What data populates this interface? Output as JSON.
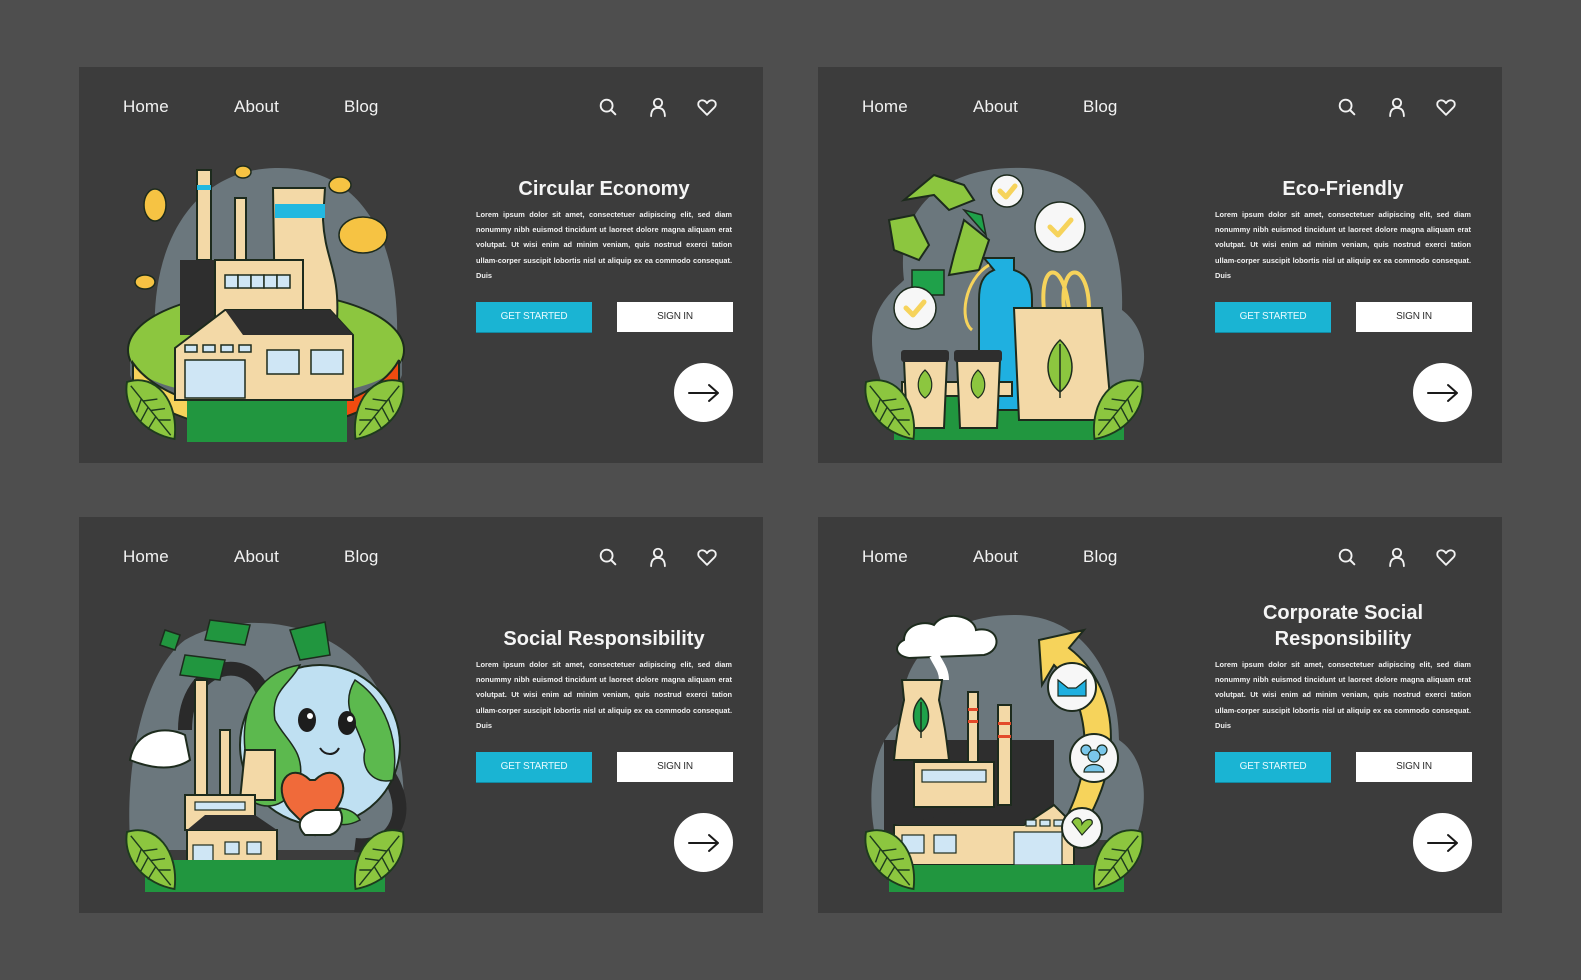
{
  "colors": {
    "page_background": "#4e4e4e",
    "panel_background": "#3c3c3c",
    "accent": "#1ab4d3",
    "text": "#f5f5f5"
  },
  "nav": {
    "links": [
      "Home",
      "About",
      "Blog"
    ],
    "icons": [
      "search-icon",
      "user-icon",
      "heart-icon"
    ]
  },
  "panels": [
    {
      "title": "Circular Economy",
      "illustration": "factory-with-circular-arrows-and-coins",
      "body": "Lorem ipsum dolor sit amet, consectetuer adipiscing elit, sed diam nonummy nibh euismod tincidunt ut laoreet dolore magna aliquam erat volutpat. Ut wisi enim ad minim veniam, quis nostrud exerci tation ullam-corper suscipit lobortis nisl ut aliquip ex ea commodo consequat. Duis",
      "primary_button": "GET STARTED",
      "secondary_button": "SIGN IN",
      "next_icon": "arrow-right-icon"
    },
    {
      "title": "Eco-Friendly",
      "illustration": "recycling-bottle-bag-cups-checkmarks",
      "body": "Lorem ipsum dolor sit amet, consectetuer adipiscing elit, sed diam nonummy nibh euismod tincidunt ut laoreet dolore magna aliquam erat volutpat. Ut wisi enim ad minim veniam, quis nostrud exerci tation ullam-corper suscipit lobortis nisl ut aliquip ex ea commodo consequat. Duis",
      "primary_button": "GET STARTED",
      "secondary_button": "SIGN IN",
      "next_icon": "arrow-right-icon"
    },
    {
      "title": "Social Responsibility",
      "illustration": "earth-character-hugging-factory-with-money",
      "body": "Lorem ipsum dolor sit amet, consectetuer adipiscing elit, sed diam nonummy nibh euismod tincidunt ut laoreet dolore magna aliquam erat volutpat. Ut wisi enim ad minim veniam, quis nostrud exerci tation ullam-corper suscipit lobortis nisl ut aliquip ex ea commodo consequat. Duis",
      "primary_button": "GET STARTED",
      "secondary_button": "SIGN IN",
      "next_icon": "arrow-right-icon"
    },
    {
      "title": "Corporate Social Responsibility",
      "illustration": "factory-with-arrow-handshake-people-leaf",
      "body": "Lorem ipsum dolor sit amet, consectetuer adipiscing elit, sed diam nonummy nibh euismod tincidunt ut laoreet dolore magna aliquam erat volutpat. Ut wisi enim ad minim veniam, quis nostrud exerci tation ullam-corper suscipit lobortis nisl ut aliquip ex ea commodo consequat. Duis",
      "primary_button": "GET STARTED",
      "secondary_button": "SIGN IN",
      "next_icon": "arrow-right-icon"
    }
  ]
}
